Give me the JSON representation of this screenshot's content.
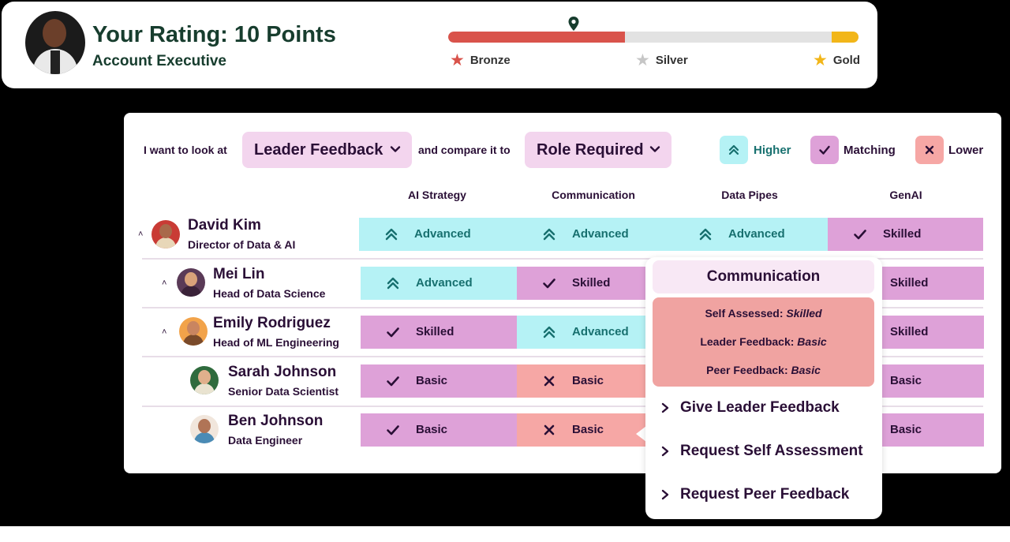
{
  "rating": {
    "title": "Your Rating: 10 Points",
    "role": "Account Executive",
    "progress_fraction": 0.43,
    "tiers": [
      {
        "name": "Bronze",
        "icon": "star-icon",
        "color": "#d9534b"
      },
      {
        "name": "Silver",
        "icon": "star-icon",
        "color": "#c6c6c6"
      },
      {
        "name": "Gold",
        "icon": "star-icon",
        "color": "#f2b619"
      }
    ]
  },
  "filters": {
    "prefix": "I want to look at",
    "view_selected": "Leader Feedback",
    "middle": "and compare it to",
    "compare_selected": "Role Required"
  },
  "legend": {
    "higher": {
      "label": "Higher",
      "color": "#b5f2f5",
      "icon": "double-chevron-up-icon"
    },
    "matching": {
      "label": "Matching",
      "color": "#dea1d8",
      "icon": "check-icon"
    },
    "lower": {
      "label": "Lower",
      "color": "#f6a7a5",
      "icon": "x-icon"
    }
  },
  "columns": [
    "AI Strategy",
    "Communication",
    "Data Pipes",
    "GenAI"
  ],
  "people": [
    {
      "name": "David Kim",
      "title": "Director of Data & AI",
      "expandable": true,
      "cells": [
        {
          "status": "higher",
          "label": "Advanced"
        },
        {
          "status": "higher",
          "label": "Advanced"
        },
        {
          "status": "higher",
          "label": "Advanced"
        },
        {
          "status": "matching",
          "label": "Skilled"
        }
      ]
    },
    {
      "name": "Mei Lin",
      "title": "Head of Data Science",
      "expandable": true,
      "cells": [
        {
          "status": "higher",
          "label": "Advanced"
        },
        {
          "status": "matching",
          "label": "Skilled"
        },
        {
          "status": "hidden",
          "label": ""
        },
        {
          "status": "matching",
          "label": "Skilled"
        }
      ]
    },
    {
      "name": "Emily Rodriguez",
      "title": "Head of ML Engineering",
      "expandable": true,
      "cells": [
        {
          "status": "matching",
          "label": "Skilled"
        },
        {
          "status": "higher",
          "label": "Advanced"
        },
        {
          "status": "hidden",
          "label": ""
        },
        {
          "status": "matching",
          "label": "Skilled"
        }
      ]
    },
    {
      "name": "Sarah Johnson",
      "title": "Senior Data Scientist",
      "expandable": false,
      "cells": [
        {
          "status": "matching",
          "label": "Basic"
        },
        {
          "status": "lower",
          "label": "Basic"
        },
        {
          "status": "hidden",
          "label": ""
        },
        {
          "status": "matching",
          "label": "Basic"
        }
      ]
    },
    {
      "name": "Ben Johnson",
      "title": "Data Engineer",
      "expandable": false,
      "cells": [
        {
          "status": "matching",
          "label": "Basic"
        },
        {
          "status": "lower",
          "label": "Basic"
        },
        {
          "status": "hidden",
          "label": ""
        },
        {
          "status": "matching",
          "label": "Basic"
        }
      ]
    }
  ],
  "popover": {
    "title": "Communication",
    "details": [
      {
        "label": "Self Assessed:",
        "value": "Skilled"
      },
      {
        "label": "Leader Feedback:",
        "value": "Basic"
      },
      {
        "label": "Peer Feedback:",
        "value": "Basic"
      }
    ],
    "actions": [
      "Give Leader Feedback",
      "Request Self Assessment",
      "Request Peer Feedback"
    ]
  }
}
